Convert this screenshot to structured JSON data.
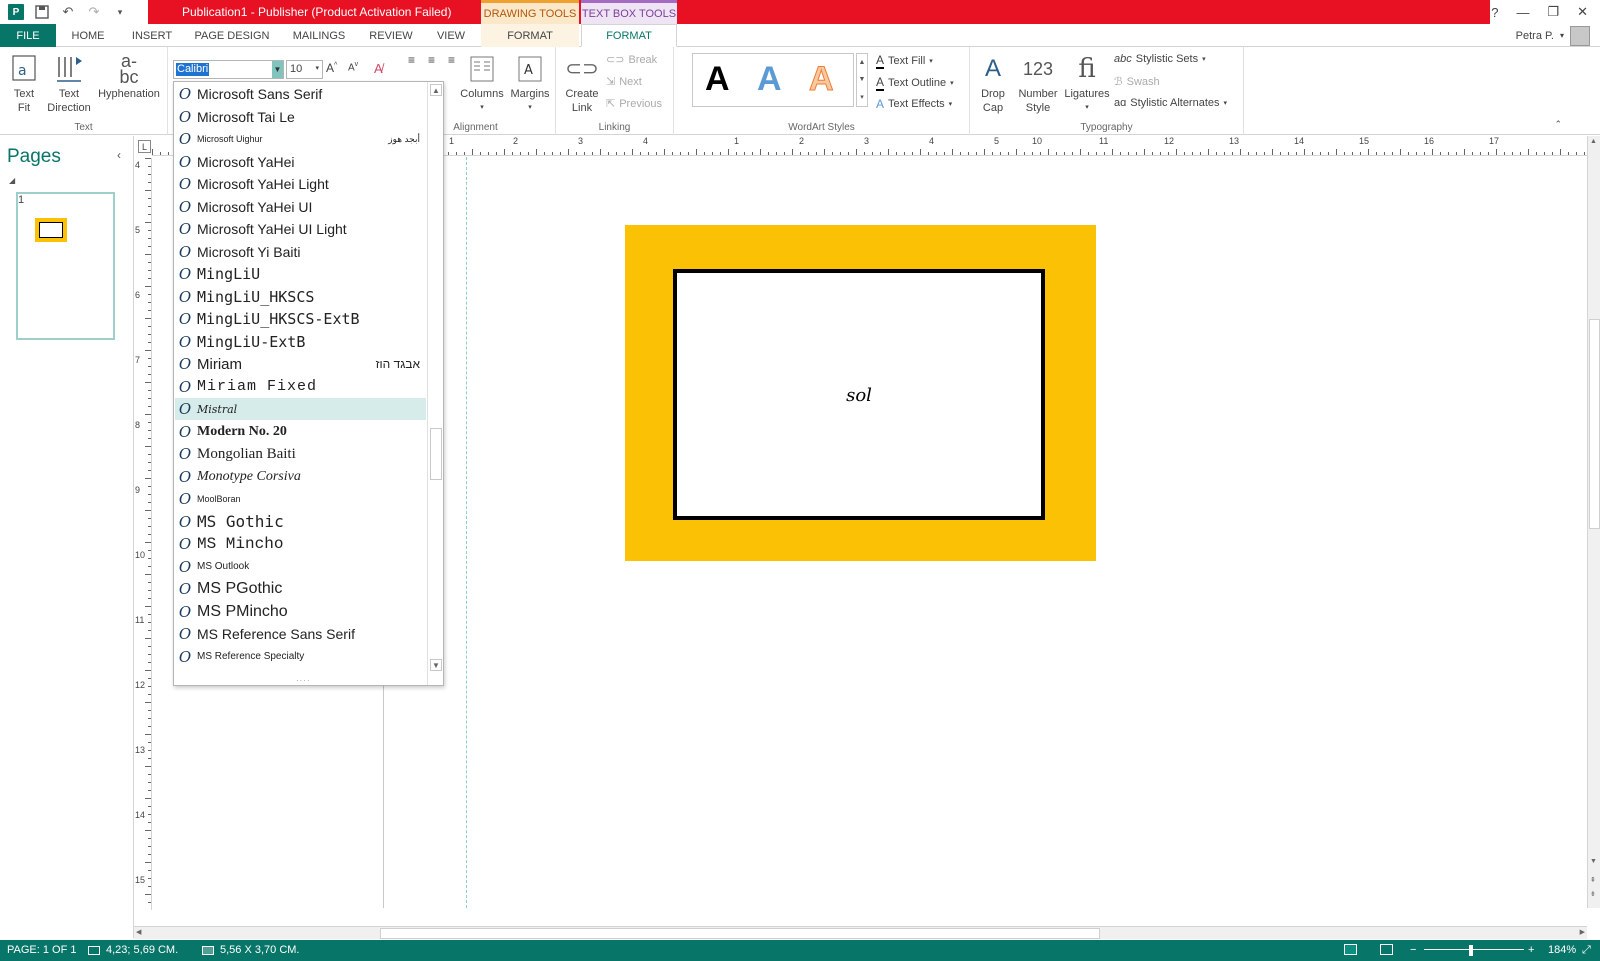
{
  "window": {
    "title": "Publication1 -  Publisher (Product Activation Failed)",
    "ctx_drawing_tools": "DRAWING TOOLS",
    "ctx_text_box_tools": "TEXT BOX TOOLS",
    "help": "?",
    "minimize": "—",
    "restore": "❐",
    "close": "✕"
  },
  "tabs": {
    "file": "FILE",
    "home": "HOME",
    "insert": "INSERT",
    "page_design": "PAGE DESIGN",
    "mailings": "MAILINGS",
    "review": "REVIEW",
    "view": "VIEW",
    "format_drawing": "FORMAT",
    "format_textbox": "FORMAT"
  },
  "user": {
    "name": "Petra P."
  },
  "ribbon": {
    "text_group": {
      "label": "Text",
      "text_fit": "Text\nFit",
      "text_fit_l1": "Text",
      "text_fit_l2": "Fit",
      "text_direction_l1": "Text",
      "text_direction_l2": "Direction",
      "hyphenation": "Hyphenation"
    },
    "font": {
      "name": "Calibri",
      "size": "10"
    },
    "alignment_group": {
      "label": "Alignment",
      "columns": "Columns",
      "margins": "Margins"
    },
    "linking_group": {
      "label": "Linking",
      "create_link_l1": "Create",
      "create_link_l2": "Link",
      "break": "Break",
      "next": "Next",
      "previous": "Previous"
    },
    "wordart_group": {
      "label": "WordArt Styles",
      "text_fill": "Text Fill",
      "text_outline": "Text Outline",
      "text_effects": "Text Effects",
      "sample": "A"
    },
    "typography_group": {
      "label": "Typography",
      "drop_cap_l1": "Drop",
      "drop_cap_l2": "Cap",
      "number_style_l1": "Number",
      "number_style_l2": "Style",
      "ligatures": "Ligatures",
      "stylistic_sets": "Stylistic Sets",
      "swash": "Swash",
      "stylistic_alternates": "Stylistic Alternates"
    }
  },
  "font_list": {
    "items": [
      {
        "name": "Microsoft Sans Serif",
        "sample": ""
      },
      {
        "name": "Microsoft Tai Le",
        "sample": ""
      },
      {
        "name": "Microsoft Uighur",
        "sample": "أبجد هوز"
      },
      {
        "name": "Microsoft YaHei",
        "sample": ""
      },
      {
        "name": "Microsoft YaHei Light",
        "sample": ""
      },
      {
        "name": "Microsoft YaHei UI",
        "sample": ""
      },
      {
        "name": "Microsoft YaHei UI Light",
        "sample": ""
      },
      {
        "name": "Microsoft  Yi  Baiti",
        "sample": ""
      },
      {
        "name": "MingLiU",
        "sample": ""
      },
      {
        "name": "MingLiU_HKSCS",
        "sample": ""
      },
      {
        "name": "MingLiU_HKSCS-ExtB",
        "sample": ""
      },
      {
        "name": "MingLiU-ExtB",
        "sample": ""
      },
      {
        "name": "Miriam",
        "sample": "אבגד הוז"
      },
      {
        "name": "Miriam Fixed",
        "sample": ""
      },
      {
        "name": "Mistral",
        "sample": ""
      },
      {
        "name": "Modern No. 20",
        "sample": ""
      },
      {
        "name": "Mongolian Baiti",
        "sample": ""
      },
      {
        "name": "Monotype Corsiva",
        "sample": ""
      },
      {
        "name": "MoolBoran",
        "sample": ""
      },
      {
        "name": "MS Gothic",
        "sample": ""
      },
      {
        "name": "MS Mincho",
        "sample": ""
      },
      {
        "name": "MS Outlook",
        "sample": ""
      },
      {
        "name": "MS PGothic",
        "sample": ""
      },
      {
        "name": "MS PMincho",
        "sample": ""
      },
      {
        "name": "MS Reference Sans Serif",
        "sample": ""
      },
      {
        "name": "MS Reference Specialty",
        "sample": ""
      }
    ],
    "highlighted": "Mistral",
    "icon_glyph": "O"
  },
  "pages_panel": {
    "title": "Pages",
    "page_number": "1"
  },
  "ruler": {
    "corner": "L",
    "h_numbers": [
      "1",
      "2",
      "3",
      "4",
      "1",
      "2",
      "3",
      "4",
      "5",
      "10",
      "11",
      "12",
      "13",
      "14",
      "15",
      "16",
      "17"
    ],
    "v_numbers": [
      "4",
      "5",
      "6",
      "7",
      "8",
      "9",
      "10",
      "11",
      "12",
      "13",
      "14",
      "15"
    ]
  },
  "canvas": {
    "textbox_text": "sol",
    "orange_color": "#fbc105"
  },
  "status": {
    "page": "PAGE: 1 OF 1",
    "position": "4,23; 5,69 CM.",
    "size": "5,56 X 3,70 CM.",
    "zoom": "184%"
  },
  "colors": {
    "accent": "#077568",
    "title_red": "#e81123"
  }
}
